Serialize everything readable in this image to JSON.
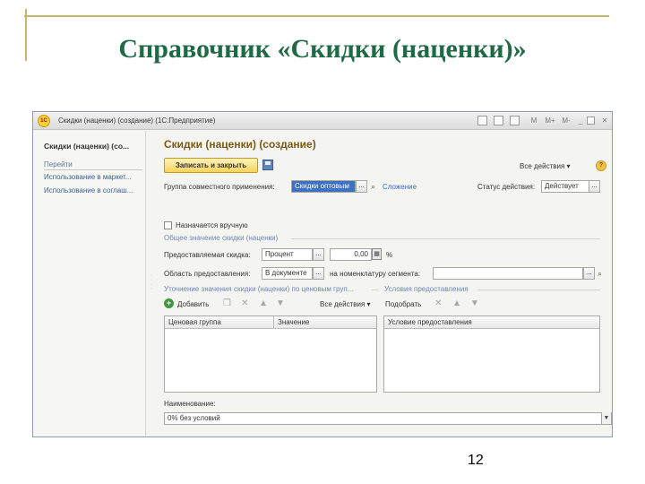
{
  "slide": {
    "title": "Справочник «Скидки (наценки)»",
    "page_number": "12"
  },
  "window": {
    "title": "Скидки (наценки) (создание)  (1С:Предприятие)",
    "toolbar_buttons": [
      "M",
      "M+",
      "M-"
    ]
  },
  "sidebar": {
    "heading": "Скидки (наценки) (со...",
    "goto_label": "Перейти",
    "links": [
      "Использование в маркет...",
      "Использование в соглаш..."
    ]
  },
  "form": {
    "title": "Скидки (наценки) (создание)",
    "save_close_label": "Записать и закрыть",
    "all_actions_label": "Все действия",
    "help_label": "?",
    "group_label": "Группа совместного применения:",
    "group_value": "Скидки оптовым",
    "dots": "...",
    "composition_link": "Сложение",
    "status_label": "Статус действия:",
    "status_value": "Действует",
    "manual_checkbox_label": "Назначается вручную",
    "manual_checked": false,
    "general_section_title": "Общее значение скидки (наценки)",
    "discount_label": "Предоставляемая скидка:",
    "discount_type": "Процент",
    "discount_value": "0,00",
    "percent_sign": "%",
    "area_label": "Область предоставления:",
    "area_value": "В документе",
    "nomenclature_label": "на номенклатуру сегмента:",
    "nomenclature_value": "",
    "refine_section_title": "Уточнение значения скидки (наценки) по ценовым груп...",
    "conditions_section_title": "Условия предоставления",
    "add_label": "Добавить",
    "left_all_actions": "Все действия",
    "pick_label": "Подобрать",
    "left_table_columns": [
      "Ценовая группа",
      "Значение"
    ],
    "right_table_columns": [
      "Условие предоставления"
    ],
    "name_label": "Наименование:",
    "name_value": "0% без условий"
  }
}
